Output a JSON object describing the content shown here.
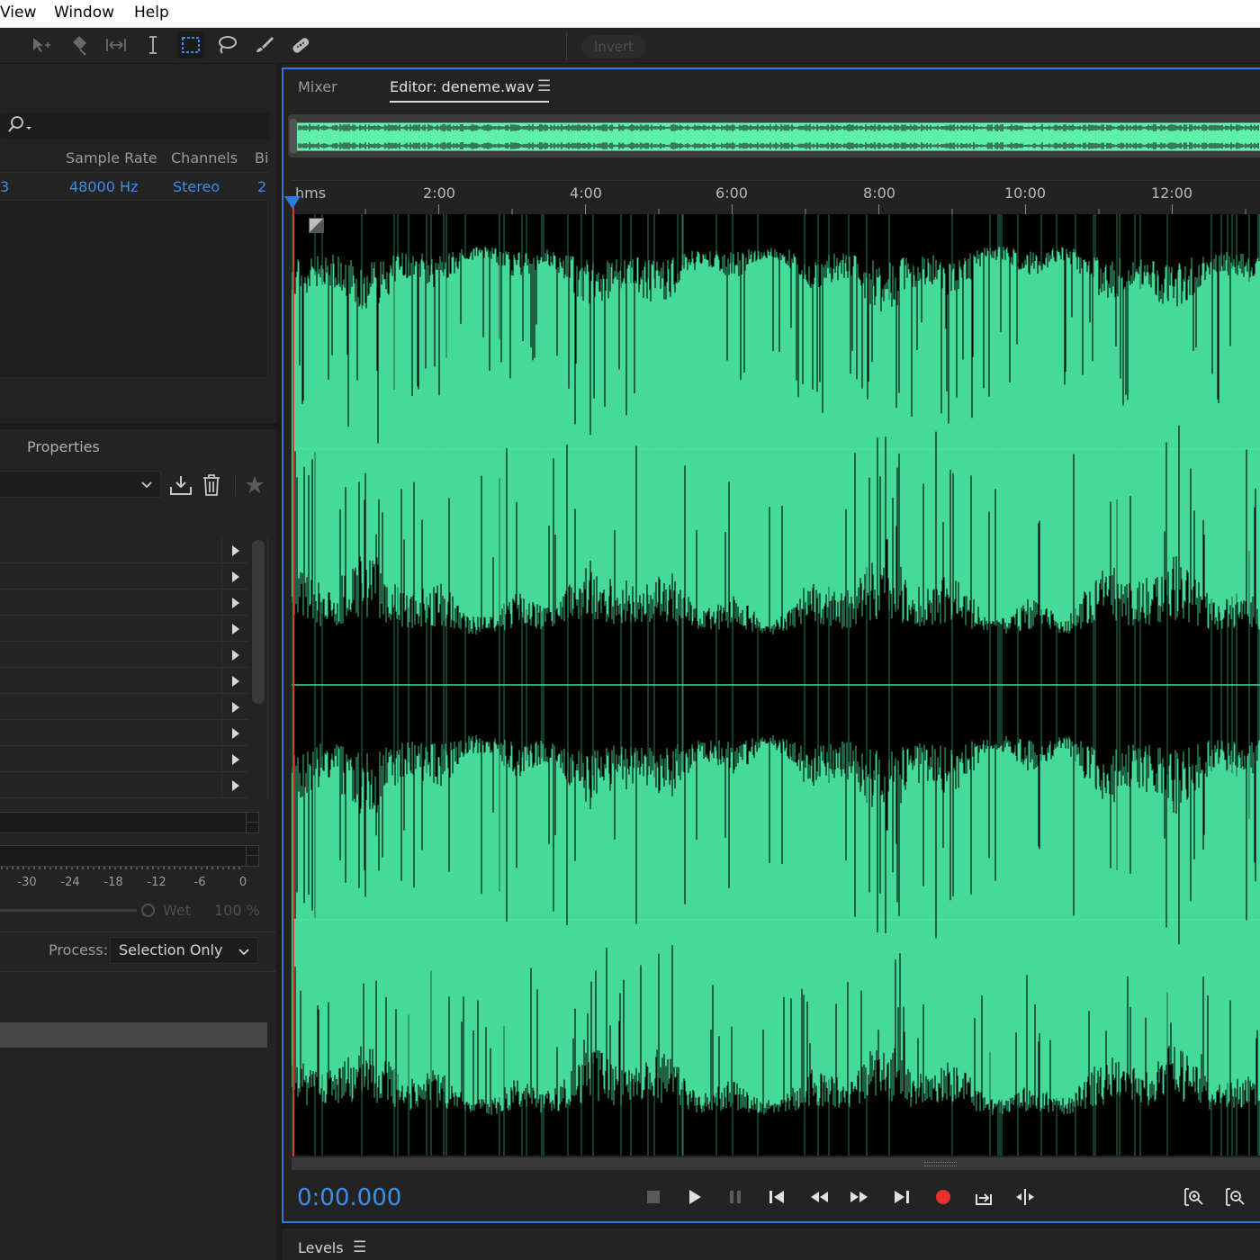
{
  "menu": {
    "items": [
      "View",
      "Window",
      "Help"
    ]
  },
  "toolbar": {
    "tools": [
      "move-icon",
      "razor-icon",
      "slip-icon",
      "time-selection-icon",
      "marquee-selection-icon",
      "lasso-selection-icon",
      "brush-selection-icon",
      "spot-healing-icon"
    ],
    "active_tool": "marquee-selection-icon",
    "invert_label": "Invert"
  },
  "files": {
    "columns": [
      "Sample Rate",
      "Channels",
      "Bi"
    ],
    "row": {
      "first_cell": "3",
      "sample_rate": "48000 Hz",
      "channels": "Stereo",
      "bit": "2"
    }
  },
  "properties": {
    "tab_label": "Properties",
    "rack_rows": 10,
    "meter_scale": [
      "-30",
      "-24",
      "-18",
      "-12",
      "-6",
      "0"
    ],
    "wet_label": "Wet",
    "wet_value": "100 %",
    "process_label": "Process:",
    "process_value": "Selection Only"
  },
  "editor": {
    "tab_mixer": "Mixer",
    "tab_editor": "Editor: deneme.wav",
    "ruler_unit": "hms",
    "ruler_marks": [
      "2:00",
      "4:00",
      "6:00",
      "8:00",
      "10:00",
      "12:00"
    ],
    "timecode": "0:00.000",
    "waveform_color": "#46da98",
    "accent": "#2f7be0"
  },
  "levels": {
    "tab_label": "Levels"
  }
}
